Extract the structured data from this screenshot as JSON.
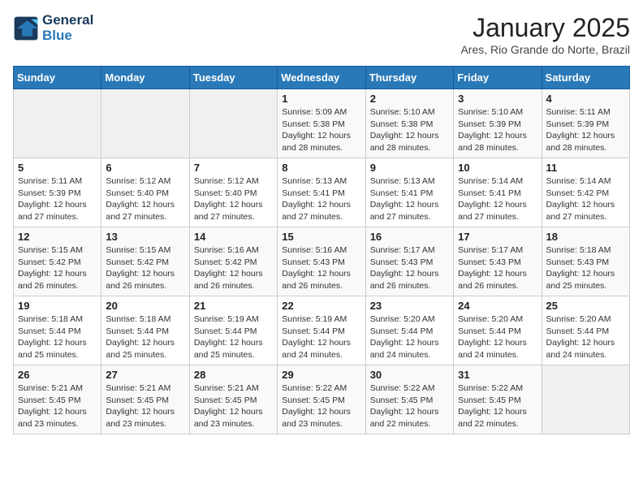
{
  "header": {
    "logo_line1": "General",
    "logo_line2": "Blue",
    "title": "January 2025",
    "subtitle": "Ares, Rio Grande do Norte, Brazil"
  },
  "weekdays": [
    "Sunday",
    "Monday",
    "Tuesday",
    "Wednesday",
    "Thursday",
    "Friday",
    "Saturday"
  ],
  "weeks": [
    [
      {
        "day": "",
        "sunrise": "",
        "sunset": "",
        "daylight": ""
      },
      {
        "day": "",
        "sunrise": "",
        "sunset": "",
        "daylight": ""
      },
      {
        "day": "",
        "sunrise": "",
        "sunset": "",
        "daylight": ""
      },
      {
        "day": "1",
        "sunrise": "Sunrise: 5:09 AM",
        "sunset": "Sunset: 5:38 PM",
        "daylight": "Daylight: 12 hours and 28 minutes."
      },
      {
        "day": "2",
        "sunrise": "Sunrise: 5:10 AM",
        "sunset": "Sunset: 5:38 PM",
        "daylight": "Daylight: 12 hours and 28 minutes."
      },
      {
        "day": "3",
        "sunrise": "Sunrise: 5:10 AM",
        "sunset": "Sunset: 5:39 PM",
        "daylight": "Daylight: 12 hours and 28 minutes."
      },
      {
        "day": "4",
        "sunrise": "Sunrise: 5:11 AM",
        "sunset": "Sunset: 5:39 PM",
        "daylight": "Daylight: 12 hours and 28 minutes."
      }
    ],
    [
      {
        "day": "5",
        "sunrise": "Sunrise: 5:11 AM",
        "sunset": "Sunset: 5:39 PM",
        "daylight": "Daylight: 12 hours and 27 minutes."
      },
      {
        "day": "6",
        "sunrise": "Sunrise: 5:12 AM",
        "sunset": "Sunset: 5:40 PM",
        "daylight": "Daylight: 12 hours and 27 minutes."
      },
      {
        "day": "7",
        "sunrise": "Sunrise: 5:12 AM",
        "sunset": "Sunset: 5:40 PM",
        "daylight": "Daylight: 12 hours and 27 minutes."
      },
      {
        "day": "8",
        "sunrise": "Sunrise: 5:13 AM",
        "sunset": "Sunset: 5:41 PM",
        "daylight": "Daylight: 12 hours and 27 minutes."
      },
      {
        "day": "9",
        "sunrise": "Sunrise: 5:13 AM",
        "sunset": "Sunset: 5:41 PM",
        "daylight": "Daylight: 12 hours and 27 minutes."
      },
      {
        "day": "10",
        "sunrise": "Sunrise: 5:14 AM",
        "sunset": "Sunset: 5:41 PM",
        "daylight": "Daylight: 12 hours and 27 minutes."
      },
      {
        "day": "11",
        "sunrise": "Sunrise: 5:14 AM",
        "sunset": "Sunset: 5:42 PM",
        "daylight": "Daylight: 12 hours and 27 minutes."
      }
    ],
    [
      {
        "day": "12",
        "sunrise": "Sunrise: 5:15 AM",
        "sunset": "Sunset: 5:42 PM",
        "daylight": "Daylight: 12 hours and 26 minutes."
      },
      {
        "day": "13",
        "sunrise": "Sunrise: 5:15 AM",
        "sunset": "Sunset: 5:42 PM",
        "daylight": "Daylight: 12 hours and 26 minutes."
      },
      {
        "day": "14",
        "sunrise": "Sunrise: 5:16 AM",
        "sunset": "Sunset: 5:42 PM",
        "daylight": "Daylight: 12 hours and 26 minutes."
      },
      {
        "day": "15",
        "sunrise": "Sunrise: 5:16 AM",
        "sunset": "Sunset: 5:43 PM",
        "daylight": "Daylight: 12 hours and 26 minutes."
      },
      {
        "day": "16",
        "sunrise": "Sunrise: 5:17 AM",
        "sunset": "Sunset: 5:43 PM",
        "daylight": "Daylight: 12 hours and 26 minutes."
      },
      {
        "day": "17",
        "sunrise": "Sunrise: 5:17 AM",
        "sunset": "Sunset: 5:43 PM",
        "daylight": "Daylight: 12 hours and 26 minutes."
      },
      {
        "day": "18",
        "sunrise": "Sunrise: 5:18 AM",
        "sunset": "Sunset: 5:43 PM",
        "daylight": "Daylight: 12 hours and 25 minutes."
      }
    ],
    [
      {
        "day": "19",
        "sunrise": "Sunrise: 5:18 AM",
        "sunset": "Sunset: 5:44 PM",
        "daylight": "Daylight: 12 hours and 25 minutes."
      },
      {
        "day": "20",
        "sunrise": "Sunrise: 5:18 AM",
        "sunset": "Sunset: 5:44 PM",
        "daylight": "Daylight: 12 hours and 25 minutes."
      },
      {
        "day": "21",
        "sunrise": "Sunrise: 5:19 AM",
        "sunset": "Sunset: 5:44 PM",
        "daylight": "Daylight: 12 hours and 25 minutes."
      },
      {
        "day": "22",
        "sunrise": "Sunrise: 5:19 AM",
        "sunset": "Sunset: 5:44 PM",
        "daylight": "Daylight: 12 hours and 24 minutes."
      },
      {
        "day": "23",
        "sunrise": "Sunrise: 5:20 AM",
        "sunset": "Sunset: 5:44 PM",
        "daylight": "Daylight: 12 hours and 24 minutes."
      },
      {
        "day": "24",
        "sunrise": "Sunrise: 5:20 AM",
        "sunset": "Sunset: 5:44 PM",
        "daylight": "Daylight: 12 hours and 24 minutes."
      },
      {
        "day": "25",
        "sunrise": "Sunrise: 5:20 AM",
        "sunset": "Sunset: 5:44 PM",
        "daylight": "Daylight: 12 hours and 24 minutes."
      }
    ],
    [
      {
        "day": "26",
        "sunrise": "Sunrise: 5:21 AM",
        "sunset": "Sunset: 5:45 PM",
        "daylight": "Daylight: 12 hours and 23 minutes."
      },
      {
        "day": "27",
        "sunrise": "Sunrise: 5:21 AM",
        "sunset": "Sunset: 5:45 PM",
        "daylight": "Daylight: 12 hours and 23 minutes."
      },
      {
        "day": "28",
        "sunrise": "Sunrise: 5:21 AM",
        "sunset": "Sunset: 5:45 PM",
        "daylight": "Daylight: 12 hours and 23 minutes."
      },
      {
        "day": "29",
        "sunrise": "Sunrise: 5:22 AM",
        "sunset": "Sunset: 5:45 PM",
        "daylight": "Daylight: 12 hours and 23 minutes."
      },
      {
        "day": "30",
        "sunrise": "Sunrise: 5:22 AM",
        "sunset": "Sunset: 5:45 PM",
        "daylight": "Daylight: 12 hours and 22 minutes."
      },
      {
        "day": "31",
        "sunrise": "Sunrise: 5:22 AM",
        "sunset": "Sunset: 5:45 PM",
        "daylight": "Daylight: 12 hours and 22 minutes."
      },
      {
        "day": "",
        "sunrise": "",
        "sunset": "",
        "daylight": ""
      }
    ]
  ]
}
